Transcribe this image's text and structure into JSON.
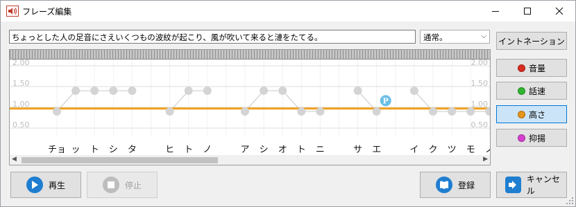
{
  "window": {
    "title": "フレーズ編集"
  },
  "phrase": {
    "text": "ちょっとした人の足音にさえいくつもの波紋が起こり、風が吹いて来ると漣をたてる。"
  },
  "mode": {
    "selected": "通常。"
  },
  "side_buttons": [
    {
      "label": "イントネーション",
      "name": "intonation-button",
      "dot": "",
      "active": false
    },
    {
      "label": "音量",
      "name": "volume-button",
      "dot": "#d92b1f",
      "active": false
    },
    {
      "label": "話速",
      "name": "speed-button",
      "dot": "#2fb52f",
      "active": false
    },
    {
      "label": "高さ",
      "name": "pitch-button",
      "dot": "#e6951a",
      "active": true
    },
    {
      "label": "抑揚",
      "name": "accent-button",
      "dot": "#d63fce",
      "active": false
    }
  ],
  "bottom_buttons": {
    "play": "再生",
    "stop": "停止",
    "register": "登録",
    "cancel": "キャンセル"
  },
  "chart_data": {
    "type": "line",
    "y_ticks": [
      "2.00",
      "1.50",
      "1.00",
      "0.50"
    ],
    "ylim": [
      0.35,
      2.15
    ],
    "pitch_level": 0.97,
    "pitch_color": "#f0a020",
    "marker": {
      "label": "P",
      "mora_index": 17,
      "value": 1.16,
      "color": "#6bbfe6"
    },
    "morae": [
      "チョ",
      "ッ",
      "ト",
      "シ",
      "タ",
      "",
      "ヒ",
      "ト",
      "ノ",
      "",
      "ア",
      "シ",
      "オ",
      "ト",
      "ニ",
      "",
      "サ",
      "エ",
      "",
      "イ",
      "ク",
      "ツ",
      "モ",
      "ノ"
    ],
    "values": [
      0.9,
      1.4,
      1.4,
      1.4,
      1.4,
      null,
      0.9,
      1.4,
      1.4,
      null,
      0.9,
      1.4,
      1.4,
      0.9,
      0.9,
      null,
      1.4,
      0.9,
      null,
      1.4,
      0.9,
      0.9,
      0.9,
      0.9
    ]
  }
}
